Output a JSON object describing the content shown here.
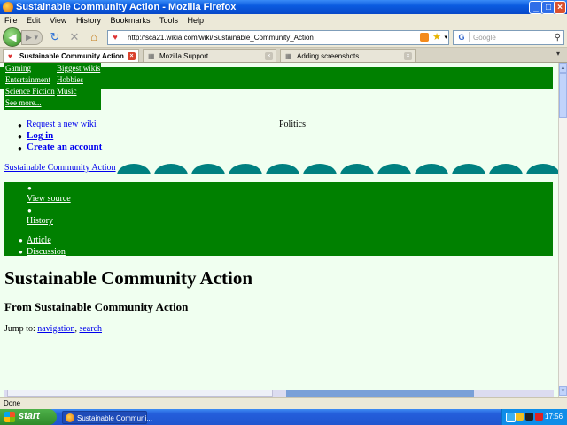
{
  "window": {
    "title": "Sustainable Community Action - Mozilla Firefox"
  },
  "menu": [
    "File",
    "Edit",
    "View",
    "History",
    "Bookmarks",
    "Tools",
    "Help"
  ],
  "toolbar": {
    "url": "http://sca21.wikia.com/wiki/Sustainable_Community_Action",
    "search_placeholder": "Google",
    "search_engine_letter": "G"
  },
  "tabs": [
    {
      "label": "Sustainable Community Action",
      "active": true
    },
    {
      "label": "Mozilla Support",
      "active": false
    },
    {
      "label": "Adding screenshots",
      "active": false
    }
  ],
  "page": {
    "dropdown": {
      "col1": [
        "Gaming",
        "Entertainment",
        "Science Fiction"
      ],
      "col2": [
        "Biggest wikis",
        "Hobbies",
        "Music"
      ],
      "more": "See more..."
    },
    "user_links": {
      "request": "Request a new wiki",
      "login": "Log in",
      "create": "Create an account"
    },
    "politics": "Politics",
    "site_link": "Sustainable Community Action",
    "actions": {
      "view_source": "View source",
      "history": "History",
      "article": "Article",
      "discussion": "Discussion"
    },
    "title": "Sustainable Community Action",
    "subtitle": "From Sustainable Community Action",
    "jump_to": {
      "prefix": "Jump to:",
      "navigation": "navigation",
      "separator": ",",
      "search": "search"
    }
  },
  "status": "Done",
  "taskbar": {
    "start": "start",
    "item": "Sustainable Communi...",
    "clock": "17:56"
  },
  "colors": {
    "green": "#008000",
    "content_bg": "#f0fff0",
    "teal": "#008080"
  }
}
